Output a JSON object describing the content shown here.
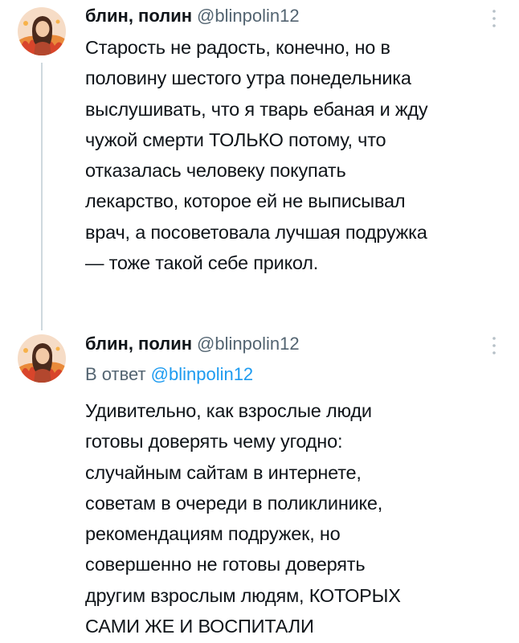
{
  "tweets": [
    {
      "display_name": "блин, полин",
      "handle": "@blinpolin12",
      "text_lines": [
        "Старость не радость, конечно, но в",
        "половину шестого утра понедельника",
        "выслушивать, что я тварь ебаная и жду",
        "чужой смерти ТОЛЬКО потому, что",
        "отказалась человеку покупать",
        "лекарство, которое ей не выписывал",
        "врач, а посоветовала лучшая подружка",
        "— тоже такой себе прикол."
      ]
    },
    {
      "display_name": "блин, полин",
      "handle": "@blinpolin12",
      "reply_label": "В ответ",
      "reply_handle": "@blinpolin12",
      "text_lines": [
        "Удивительно, как взрослые люди",
        "готовы доверять чему угодно:",
        "случайным сайтам в интернете,",
        "советам в очереди в поликлинике,",
        "рекомендациям подружек, но",
        "совершенно не готовы доверять",
        "другим взрослым людям, КОТОРЫХ",
        "САМИ ЖЕ И ВОСПИТАЛИ"
      ]
    }
  ],
  "colors": {
    "text": "#0f1419",
    "secondary": "#536471",
    "link": "#1d9bf0",
    "thread_line": "#cfd9de"
  },
  "icons": {
    "avatar": "avatar-illustration",
    "more": "more-vertical-icon"
  }
}
